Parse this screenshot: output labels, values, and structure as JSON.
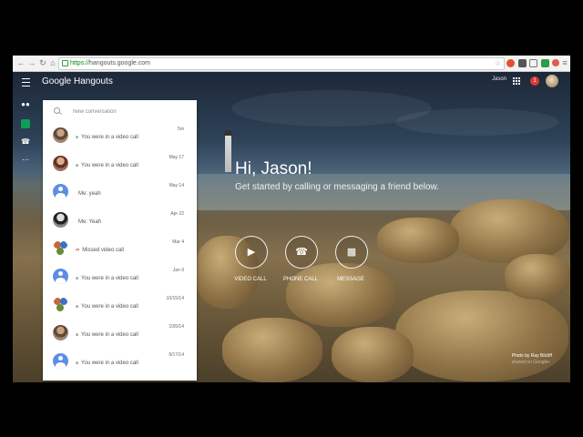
{
  "browser": {
    "url_protocol": "https://",
    "url_host": "hangouts.google.com"
  },
  "app": {
    "logo_text": "Google Hangouts",
    "user_name": "Jason",
    "notification_count": "1"
  },
  "search": {
    "placeholder": "New conversation"
  },
  "conversations": [
    {
      "snippet": "You were in a video call",
      "date": "5m",
      "type": "video",
      "avatar": "photo"
    },
    {
      "snippet": "You were in a video call",
      "date": "May 17",
      "type": "video",
      "avatar": "photo2"
    },
    {
      "snippet": "Me: yeah",
      "date": "May 14",
      "type": "text",
      "avatar": "default"
    },
    {
      "snippet": "Me: Yeah",
      "date": "Apr 22",
      "type": "text",
      "avatar": "photo3"
    },
    {
      "snippet": "Missed video call",
      "date": "Mar 4",
      "type": "missed",
      "avatar": "group"
    },
    {
      "snippet": "You were in a video call",
      "date": "Jan 9",
      "type": "video",
      "avatar": "default"
    },
    {
      "snippet": "You were in a video call",
      "date": "10/15/14",
      "type": "video",
      "avatar": "group"
    },
    {
      "snippet": "You were in a video call",
      "date": "10/5/14",
      "type": "video",
      "avatar": "photo"
    },
    {
      "snippet": "You were in a video call",
      "date": "9/17/14",
      "type": "video",
      "avatar": "default"
    }
  ],
  "main": {
    "greeting": "Hi, Jason!",
    "subtitle": "Get started by calling or messaging a friend below.",
    "actions": [
      {
        "label": "VIDEO CALL",
        "icon": "video-camera-icon"
      },
      {
        "label": "PHONE CALL",
        "icon": "phone-icon"
      },
      {
        "label": "MESSAGE",
        "icon": "message-icon"
      }
    ]
  },
  "photo_credit": {
    "line1": "Photo by Ray Bilcliff",
    "line2": "shared on Google+"
  },
  "colors": {
    "accent": "#5b8ee6",
    "notification": "#dd3b2e",
    "rail_active": "#0f9d58"
  }
}
